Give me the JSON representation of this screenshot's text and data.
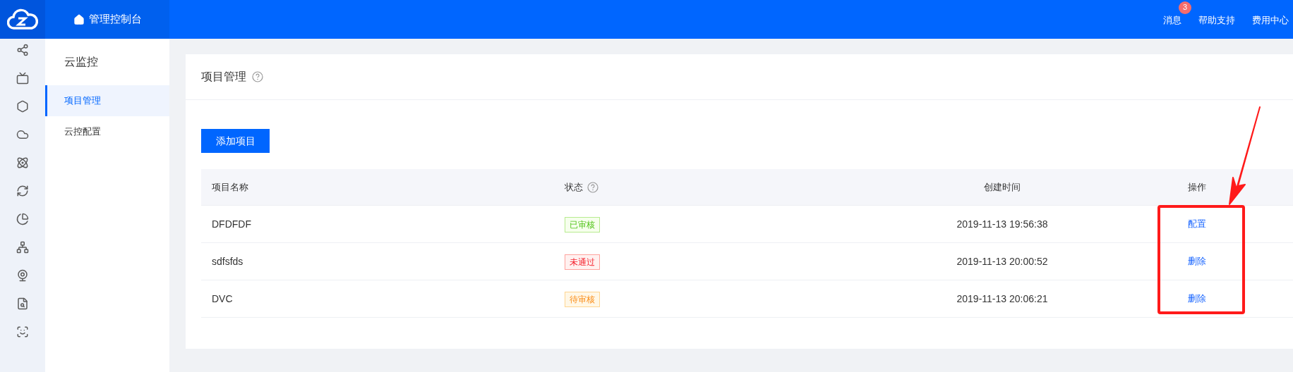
{
  "topbar": {
    "brand": "管理控制台",
    "links": [
      {
        "label": "消息",
        "badge": "3"
      },
      {
        "label": "帮助支持"
      },
      {
        "label": "费用中心"
      }
    ]
  },
  "sidebar": {
    "title": "云监控",
    "items": [
      {
        "label": "项目管理",
        "selected": true
      },
      {
        "label": "云控配置",
        "selected": false
      }
    ]
  },
  "card": {
    "title": "项目管理",
    "add_button": "添加项目"
  },
  "table": {
    "columns": [
      {
        "label": "项目名称",
        "help": false
      },
      {
        "label": "状态",
        "help": true
      },
      {
        "label": "创建时间",
        "help": false
      },
      {
        "label": "操作",
        "help": false
      }
    ],
    "rows": [
      {
        "name": "DFDFDF",
        "status": "已审核",
        "kind": "approved",
        "created": "2019-11-13 19:56:38",
        "action": "配置"
      },
      {
        "name": "sdfsfds",
        "status": "未通过",
        "kind": "rejected",
        "created": "2019-11-13 20:00:52",
        "action": "删除"
      },
      {
        "name": "DVC",
        "status": "待审核",
        "kind": "pending",
        "created": "2019-11-13 20:06:21",
        "action": "删除"
      }
    ]
  }
}
